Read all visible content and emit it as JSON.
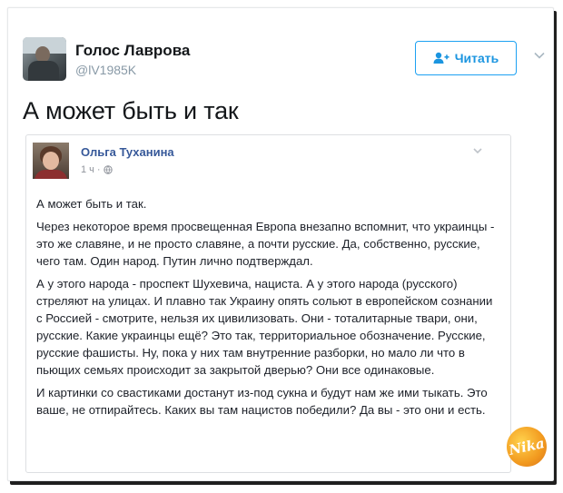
{
  "tweet": {
    "author_name": "Голос Лаврова",
    "author_handle": "@lV1985K",
    "follow_label": "Читать",
    "text": "А может быть и так",
    "accent_color": "#1da1f2"
  },
  "embedded_post": {
    "author_name": "Ольга Туханина",
    "time": "1 ч",
    "paragraphs": [
      "А может быть и так.",
      "Через некоторое время просвещенная Европа внезапно вспомнит, что украинцы - это же славяне, и не просто славяне, а почти русские. Да, собственно, русские, чего там. Один народ. Путин лично подтверждал.",
      "А у этого народа - проспект Шухевича, нациста. А у этого народа (русского) стреляют на улицах. И плавно так Украину опять сольют в европейском сознании с Россией - смотрите, нельзя их цивилизовать. Они - тоталитарные твари, они, русские. Какие украинцы ещё? Это так, территориальное обозначение. Русские, русские фашисты. Ну, пока у них там внутренние разборки, но мало ли что в пьющих семьях происходит за закрытой дверью? Они все одинаковые.",
      "И картинки со свастиками достанут из-под сукна и будут нам же ими тыкать. Это ваше, не отпирайтесь. Каких вы там нацистов победили? Да вы - это они и есть."
    ],
    "link_color": "#365899"
  },
  "watermark": {
    "text": "Nika"
  },
  "icons": {
    "follow": "add-person-icon",
    "caret": "chevron-down-icon",
    "privacy": "globe-icon",
    "logo": "watermark-logo"
  }
}
